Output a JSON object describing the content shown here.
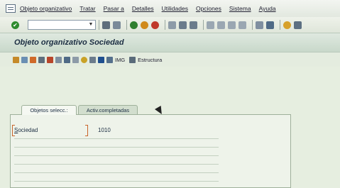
{
  "menu": {
    "items": [
      {
        "label": "Objeto organizativo"
      },
      {
        "label": "Tratar"
      },
      {
        "label": "Pasar a"
      },
      {
        "label": "Detalles"
      },
      {
        "label": "Utilidades"
      },
      {
        "label": "Opciones"
      },
      {
        "label": "Sistema"
      },
      {
        "label": "Ayuda"
      }
    ]
  },
  "toolbar": {
    "command_value": "",
    "ok_symbol": "✔",
    "dropdown_symbol": "▼"
  },
  "title": {
    "text": "Objeto organizativo Sociedad"
  },
  "app_toolbar": {
    "img_label": "IMG",
    "estructura_label": "Estructura"
  },
  "tabs": [
    {
      "label": "Objetos selecc.:"
    },
    {
      "label": "Activ.completadas"
    }
  ],
  "fields": {
    "sociedad_label": "Sociedad",
    "sociedad_value": "1010"
  },
  "colors": {
    "title_bg": "#c8d8ca",
    "accent_orange": "#c8642a",
    "ok_green": "#2e8b2e"
  }
}
